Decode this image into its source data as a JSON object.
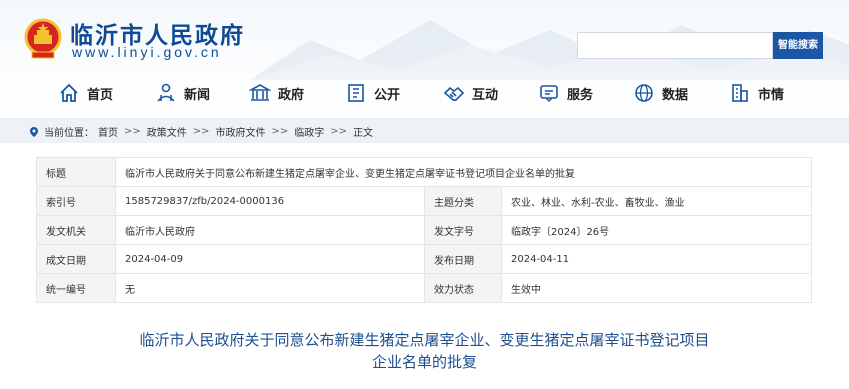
{
  "header": {
    "site_title": "临沂市人民政府",
    "site_url": "www.linyi.gov.cn",
    "search_button": "智能搜索"
  },
  "nav": [
    {
      "label": "首页",
      "icon": "home-icon"
    },
    {
      "label": "新闻",
      "icon": "news-icon"
    },
    {
      "label": "政府",
      "icon": "government-building-icon"
    },
    {
      "label": "公开",
      "icon": "document-icon"
    },
    {
      "label": "互动",
      "icon": "handshake-icon"
    },
    {
      "label": "服务",
      "icon": "service-icon"
    },
    {
      "label": "数据",
      "icon": "data-globe-icon"
    },
    {
      "label": "市情",
      "icon": "city-building-icon"
    }
  ],
  "breadcrumb": {
    "prefix": "当前位置：",
    "items": [
      "首页",
      "政策文件",
      "市政府文件",
      "临政字",
      "正文"
    ],
    "separator": ">>"
  },
  "info": {
    "title_label": "标题",
    "title_value": "临沂市人民政府关于同意公布新建生猪定点屠宰企业、变更生猪定点屠宰证书登记项目企业名单的批复",
    "rows": [
      {
        "l1": "索引号",
        "v1": "1585729837/zfb/2024-0000136",
        "l2": "主题分类",
        "v2": "农业、林业、水利-农业、畜牧业、渔业"
      },
      {
        "l1": "发文机关",
        "v1": "临沂市人民政府",
        "l2": "发文字号",
        "v2": "临政字〔2024〕26号"
      },
      {
        "l1": "成文日期",
        "v1": "2024-04-09",
        "l2": "发布日期",
        "v2": "2024-04-11"
      },
      {
        "l1": "统一编号",
        "v1": "无",
        "l2": "效力状态",
        "v2": "生效中"
      }
    ]
  },
  "document": {
    "title_line1": "临沂市人民政府关于同意公布新建生猪定点屠宰企业、变更生猪定点屠宰证书登记项目",
    "title_line2": "企业名单的批复"
  },
  "colors": {
    "brand_blue": "#0f4a93",
    "button_blue": "#1b57a5",
    "emblem_red": "#d7261e",
    "emblem_gold": "#f2c230"
  }
}
